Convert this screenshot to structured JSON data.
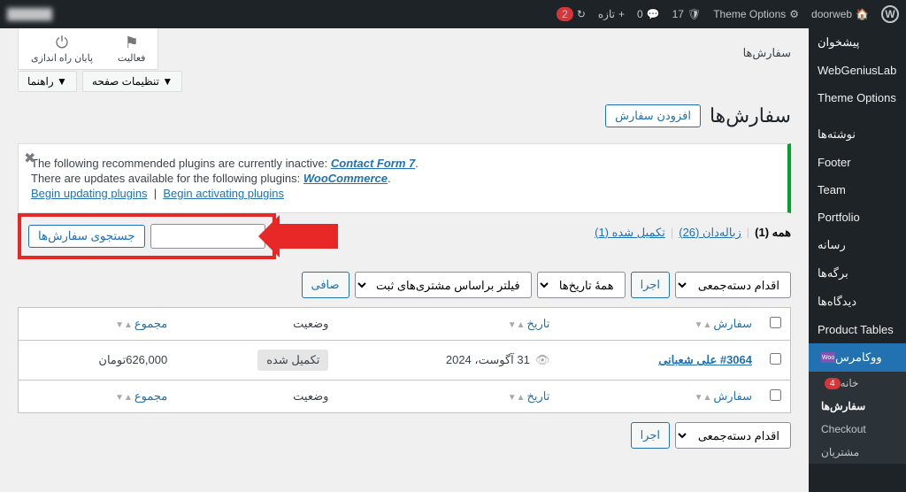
{
  "adminbar": {
    "site_name": "doorweb",
    "theme_options": "Theme Options",
    "comments": "0",
    "comments_pending": "17",
    "new": "تازه",
    "updates": "2"
  },
  "activity": {
    "finish": "پایان راه اندازی",
    "activity": "فعالیت"
  },
  "screen": {
    "options": "تنظیمات صفحه ▼",
    "help": "راهنما ▼"
  },
  "sidebar": {
    "dashboard": "پیشخوان",
    "webgenius": "WebGeniusLab",
    "theme_options": "Theme Options",
    "posts": "نوشته‌ها",
    "footer": "Footer",
    "team": "Team",
    "portfolio": "Portfolio",
    "media": "رسانه",
    "pages": "برگه‌ها",
    "comments": "دیدگاه‌ها",
    "product_tables": "Product Tables",
    "woocommerce": "ووکامرس",
    "sub": {
      "home": "خانه",
      "home_badge": "4",
      "orders": "سفارش‌ها",
      "checkout": "Checkout",
      "customers": "مشتریان"
    }
  },
  "page": {
    "title": "سفارش‌ها",
    "breadcrumb": "سفارش‌ها",
    "add_button": "افزودن سفارش"
  },
  "notice": {
    "l1a": "The following recommended plugins are currently inactive:",
    "l1b": "Contact Form 7",
    "l2a": "There are updates available for the following plugins:",
    "l2b": "WooCommerce",
    "a1": "Begin updating plugins",
    "a2": "Begin activating plugins"
  },
  "views": {
    "all": "همه (1)",
    "trash": "زباله‌دان (26)",
    "completed": "تکمیل شده (1)"
  },
  "search": {
    "button": "جستجوی سفارش‌ها"
  },
  "filters": {
    "bulk": "اقدام دسته‌جمعی",
    "apply": "اجرا",
    "dates": "همهٔ تاریخ‌ها",
    "customers": "فیلتر براساس مشتری‌های ثبت‌نام...",
    "filter": "صافی"
  },
  "table": {
    "col_order": "سفارش",
    "col_date": "تاریخ",
    "col_status": "وضعیت",
    "col_total": "مجموع",
    "row": {
      "order": "#3064 علی شعبانی",
      "date": "31 آگوست، 2024",
      "status": "تکمیل شده",
      "total": "626,000تومان"
    }
  }
}
